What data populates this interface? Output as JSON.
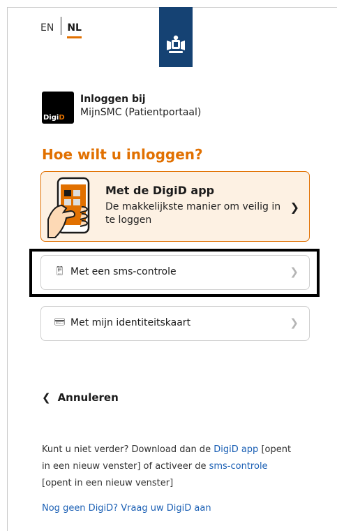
{
  "language": {
    "en": "EN",
    "nl": "NL",
    "active": "NL"
  },
  "brand": {
    "accent": "#e17000",
    "dark_blue": "#154273",
    "link": "#1a5fb4"
  },
  "context": {
    "logo_digi": "Digi",
    "logo_d": "D",
    "title": "Inloggen bij",
    "subtitle": "MijnSMC (Patientportaal)"
  },
  "heading": "Hoe wilt u inloggen?",
  "options": {
    "app": {
      "title": "Met de DigiD app",
      "description": "De makkelijkste manier om veilig in te loggen",
      "icon": "phone-hand-icon"
    },
    "sms": {
      "label": "Met een sms-controle",
      "icon": "mobile-phone-icon"
    },
    "id_card": {
      "label": "Met mijn identiteitskaart",
      "icon": "id-card-icon"
    }
  },
  "cancel": "Annuleren",
  "help": {
    "p1_a": "Kunt u niet verder? Download dan de ",
    "link_app": "DigiD app",
    "p1_b": " [opent in een nieuw venster] of activeer de ",
    "link_sms": "sms-controle",
    "p1_c": " [opent in een nieuw venster]",
    "no_digid_link": "Nog geen DigiD? Vraag uw DigiD aan"
  }
}
